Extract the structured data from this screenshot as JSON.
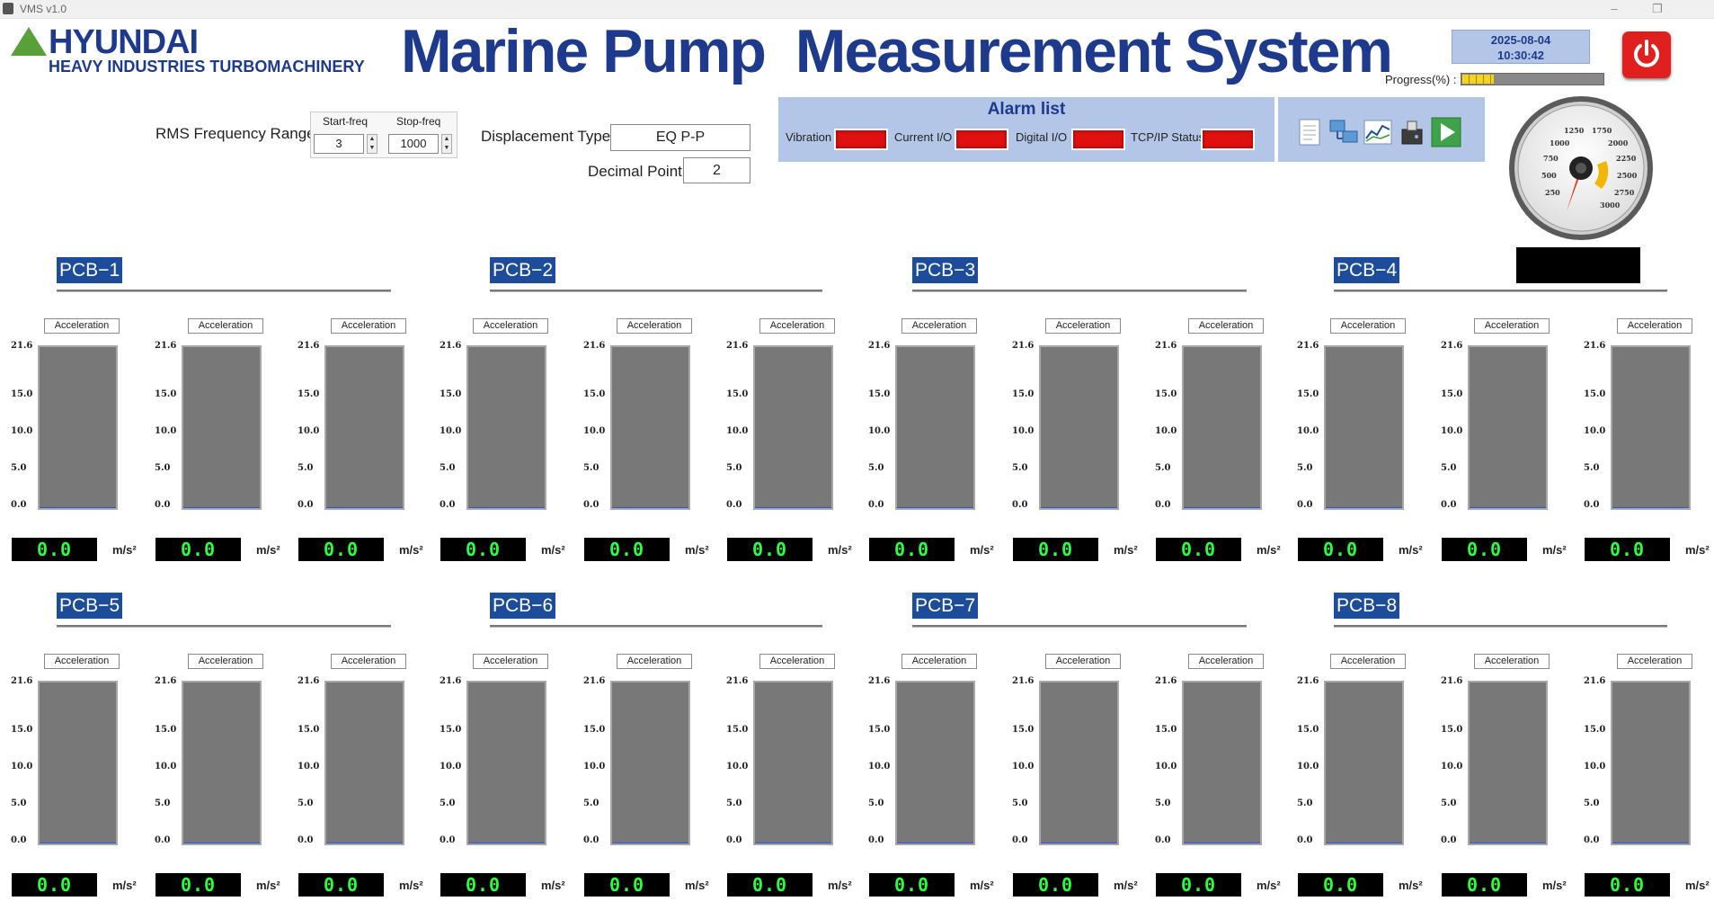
{
  "window": {
    "title": "VMS v1.0",
    "controls": [
      "–",
      "❐"
    ]
  },
  "brand": {
    "name": "HYUNDAI",
    "subtitle": "HEAVY INDUSTRIES TURBOMACHINERY",
    "accent": "#1d3a8c",
    "logo_green": "#5aa03a"
  },
  "header": {
    "title": "Marine Pump  Measurement System",
    "date": "2025-08-04",
    "time": "10:30:42",
    "progress_label": "Progress(%) :",
    "progress_fraction": 0.22
  },
  "settings": {
    "rms_label": "RMS Frequency Range",
    "start_freq_label": "Start-freq",
    "start_freq": "3",
    "stop_freq_label": "Stop-freq",
    "stop_freq": "1000",
    "displacement_label": "Displacement Type",
    "displacement_value": "EQ P-P",
    "decimal_label": "Decimal Point",
    "decimal_value": "2"
  },
  "alarm": {
    "title": "Alarm list",
    "items": [
      {
        "label": "Vibration",
        "status_color": "#e01010"
      },
      {
        "label": "Current I/O",
        "status_color": "#e01010"
      },
      {
        "label": "Digital I/O",
        "status_color": "#e01010"
      },
      {
        "label": "TCP/IP Status",
        "status_color": "#e01010"
      }
    ]
  },
  "toolbar": {
    "icons": [
      "report-icon",
      "network-icon",
      "trend-chart-icon",
      "device-icon",
      "play-icon"
    ]
  },
  "gauge": {
    "ticks": [
      "250",
      "500",
      "750",
      "1000",
      "1250",
      "1750",
      "2000",
      "2250",
      "2500",
      "2750",
      "3000"
    ]
  },
  "channel": {
    "label": "Acceleration",
    "unit": "m/s²",
    "display_value": "0.0",
    "level_fraction": 0,
    "ticks": [
      "21.6",
      "15.0",
      "10.0",
      "5.0",
      "0.0"
    ]
  },
  "pcbs": [
    {
      "name": "PCB−1"
    },
    {
      "name": "PCB−2"
    },
    {
      "name": "PCB−3"
    },
    {
      "name": "PCB−4"
    },
    {
      "name": "PCB−5"
    },
    {
      "name": "PCB−6"
    },
    {
      "name": "PCB−7"
    },
    {
      "name": "PCB−8"
    }
  ]
}
